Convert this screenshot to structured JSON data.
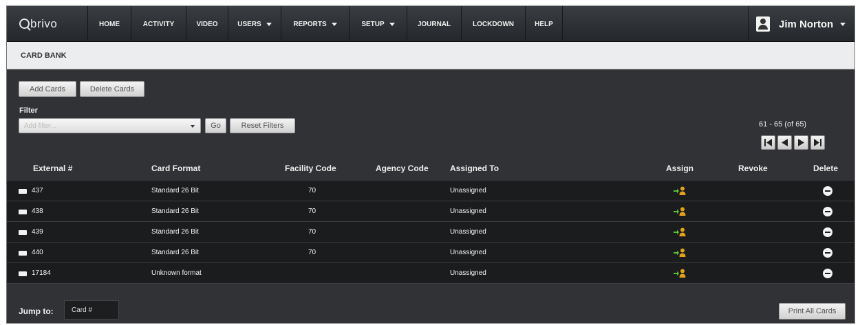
{
  "brand": {
    "logo_text": "brivo"
  },
  "nav": {
    "items": [
      {
        "label": "HOME"
      },
      {
        "label": "ACTIVITY"
      },
      {
        "label": "VIDEO"
      },
      {
        "label": "USERS"
      },
      {
        "label": "REPORTS"
      },
      {
        "label": "SETUP"
      },
      {
        "label": "JOURNAL"
      },
      {
        "label": "LOCKDOWN"
      },
      {
        "label": "HELP"
      }
    ],
    "user_name": "Jim Norton"
  },
  "page": {
    "title": "CARD BANK"
  },
  "actions": {
    "add_cards": "Add Cards",
    "delete_cards": "Delete Cards"
  },
  "filter": {
    "label": "Filter",
    "placeholder": "Add filter...",
    "go": "Go",
    "reset": "Reset Filters"
  },
  "pagination": {
    "range_text": "61 - 65 (of 65)"
  },
  "table": {
    "headers": {
      "external": "External #",
      "card_format": "Card Format",
      "facility_code": "Facility Code",
      "agency_code": "Agency Code",
      "assigned_to": "Assigned To",
      "assign": "Assign",
      "revoke": "Revoke",
      "delete": "Delete"
    },
    "rows": [
      {
        "external": "437",
        "card_format": "Standard 26 Bit",
        "facility_code": "70",
        "agency_code": "",
        "assigned_to": "Unassigned"
      },
      {
        "external": "438",
        "card_format": "Standard 26 Bit",
        "facility_code": "70",
        "agency_code": "",
        "assigned_to": "Unassigned"
      },
      {
        "external": "439",
        "card_format": "Standard 26 Bit",
        "facility_code": "70",
        "agency_code": "",
        "assigned_to": "Unassigned"
      },
      {
        "external": "440",
        "card_format": "Standard 26 Bit",
        "facility_code": "70",
        "agency_code": "",
        "assigned_to": "Unassigned"
      },
      {
        "external": "17184",
        "card_format": "Unknown format",
        "facility_code": "",
        "agency_code": "",
        "assigned_to": "Unassigned"
      }
    ]
  },
  "footer": {
    "jump_label": "Jump to:",
    "jump_placeholder": "Card #",
    "print_all": "Print All Cards"
  },
  "colors": {
    "nav_bg": "#2b2e32",
    "content_bg": "#313235",
    "row_bg": "#1b1c1e",
    "assign_green": "#5cbf3a",
    "assign_person": "#e0a21b"
  }
}
